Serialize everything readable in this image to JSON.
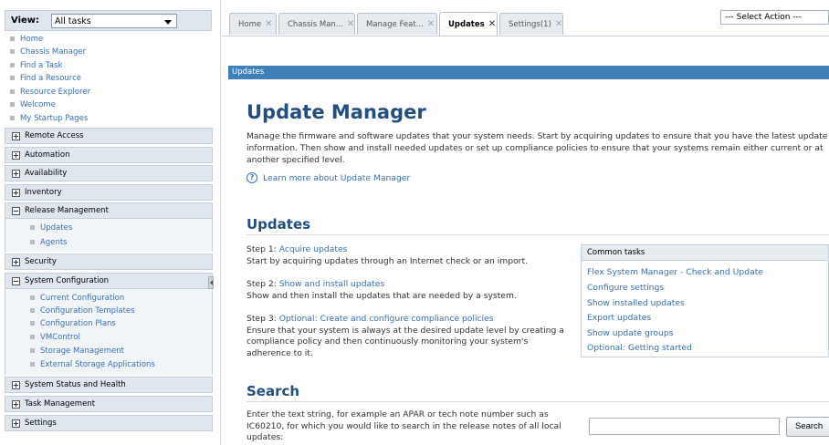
{
  "nav": {
    "view_label": "View:",
    "view_value": "All tasks",
    "top_links": [
      "Home",
      "Chassis Manager",
      "Find a Task",
      "Find a Resource",
      "Resource Explorer",
      "Welcome",
      "My Startup Pages"
    ],
    "sections": {
      "remote_access": "Remote Access",
      "automation": "Automation",
      "availability": "Availability",
      "inventory": "Inventory",
      "release_management": "Release Management",
      "security": "Security",
      "system_configuration": "System Configuration",
      "system_status": "System Status and Health",
      "task_management": "Task Management",
      "settings": "Settings"
    },
    "release_items": [
      "Updates",
      "Agents"
    ],
    "sysconfig_items": [
      "Current Configuration",
      "Configuration Templates",
      "Configuration Plans",
      "VMControl",
      "Storage Management",
      "External Storage Applications"
    ]
  },
  "tabs": [
    {
      "label": "Home"
    },
    {
      "label": "Chassis Man..."
    },
    {
      "label": "Manage Feat..."
    },
    {
      "label": "Updates"
    },
    {
      "label": "Settings(1)"
    }
  ],
  "tab_close": "✕",
  "select_action": "--- Select Action ---",
  "breadcrumb": "Updates",
  "main": {
    "title": "Update Manager",
    "intro": "Manage the firmware and software updates that your system needs. Start by acquiring updates to ensure that you have the latest update information. Then show and install needed updates or set up compliance policies to ensure that your systems remain either current or at another specified level.",
    "help_icon": "?",
    "learn_more": "Learn more about Update Manager",
    "updates_heading": "Updates",
    "step1_label": "Step 1: ",
    "step1_link": "Acquire updates",
    "step1_desc": "Start by acquiring updates through an Internet check or an import.",
    "step2_label": "Step 2: ",
    "step2_link": "Show and install updates",
    "step2_desc": "Show and then install the updates that are needed by a system.",
    "step3_label": "Step 3: ",
    "step3_link": "Optional: Create and configure compliance policies",
    "step3_desc": "Ensure that your system is always at the desired update level by creating a compliance policy and then continuously monitoring your system's adherence to it.",
    "common_tasks": {
      "heading": "Common tasks",
      "items": [
        "Flex System Manager - Check and Update",
        "Configure settings",
        "Show installed updates",
        "Export updates",
        "Show update groups",
        "Optional: Getting started"
      ]
    },
    "search_heading": "Search",
    "search_desc": "Enter the text string, for example an APAR or tech note number such as IC60210, for which you would like to search in the release notes of all local updates:",
    "search_value": "",
    "search_button": "Search"
  }
}
